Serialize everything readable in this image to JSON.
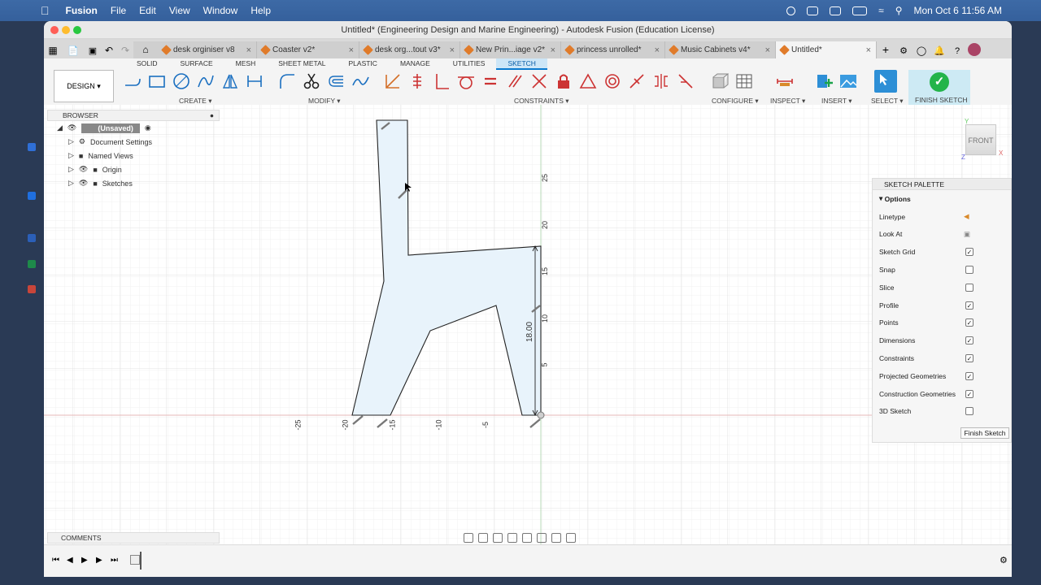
{
  "menubar": {
    "app": "Fusion",
    "items": [
      "File",
      "Edit",
      "View",
      "Window",
      "Help"
    ],
    "datetime": "Mon Oct 6  11:56 AM"
  },
  "window": {
    "title": "Untitled* (Engineering Design and Marine Engineering) - Autodesk Fusion (Education License)"
  },
  "tabs": [
    {
      "label": "desk orginiser v8"
    },
    {
      "label": "Coaster v2*"
    },
    {
      "label": "desk org...tout v3*"
    },
    {
      "label": "New Prin...iage v2*"
    },
    {
      "label": "princess unrolled*"
    },
    {
      "label": "Music Cabinets v4*"
    },
    {
      "label": "Untitled*"
    }
  ],
  "ribbon": {
    "workspace": "DESIGN",
    "tabs": [
      "SOLID",
      "SURFACE",
      "MESH",
      "SHEET METAL",
      "PLASTIC",
      "MANAGE",
      "UTILITIES",
      "SKETCH"
    ],
    "groups": [
      "CREATE",
      "MODIFY",
      "CONSTRAINTS",
      "CONFIGURE",
      "INSPECT",
      "INSERT",
      "SELECT",
      "FINISH SKETCH"
    ]
  },
  "browser": {
    "header": "BROWSER",
    "root": "(Unsaved)",
    "items": [
      "Document Settings",
      "Named Views",
      "Origin",
      "Sketches"
    ]
  },
  "palette": {
    "header": "SKETCH PALETTE",
    "section": "Options",
    "options": [
      {
        "label": "Linetype",
        "checked": null
      },
      {
        "label": "Look At",
        "checked": null
      },
      {
        "label": "Sketch Grid",
        "checked": true
      },
      {
        "label": "Snap",
        "checked": false
      },
      {
        "label": "Slice",
        "checked": false
      },
      {
        "label": "Profile",
        "checked": true
      },
      {
        "label": "Points",
        "checked": true
      },
      {
        "label": "Dimensions",
        "checked": true
      },
      {
        "label": "Constraints",
        "checked": true
      },
      {
        "label": "Projected Geometries",
        "checked": true
      },
      {
        "label": "Construction Geometries",
        "checked": true
      },
      {
        "label": "3D Sketch",
        "checked": false
      }
    ],
    "finish_button": "Finish Sketch"
  },
  "sketch": {
    "dimension": "18.00",
    "y_ticks": [
      "5",
      "10",
      "15",
      "20",
      "25"
    ],
    "x_ticks": [
      "-25",
      "-20",
      "-15",
      "-10",
      "-5"
    ]
  },
  "viewcube": {
    "face": "FRONT",
    "axis_x": "X",
    "axis_y": "Y",
    "axis_z": "Z"
  },
  "comments": {
    "label": "COMMENTS"
  }
}
